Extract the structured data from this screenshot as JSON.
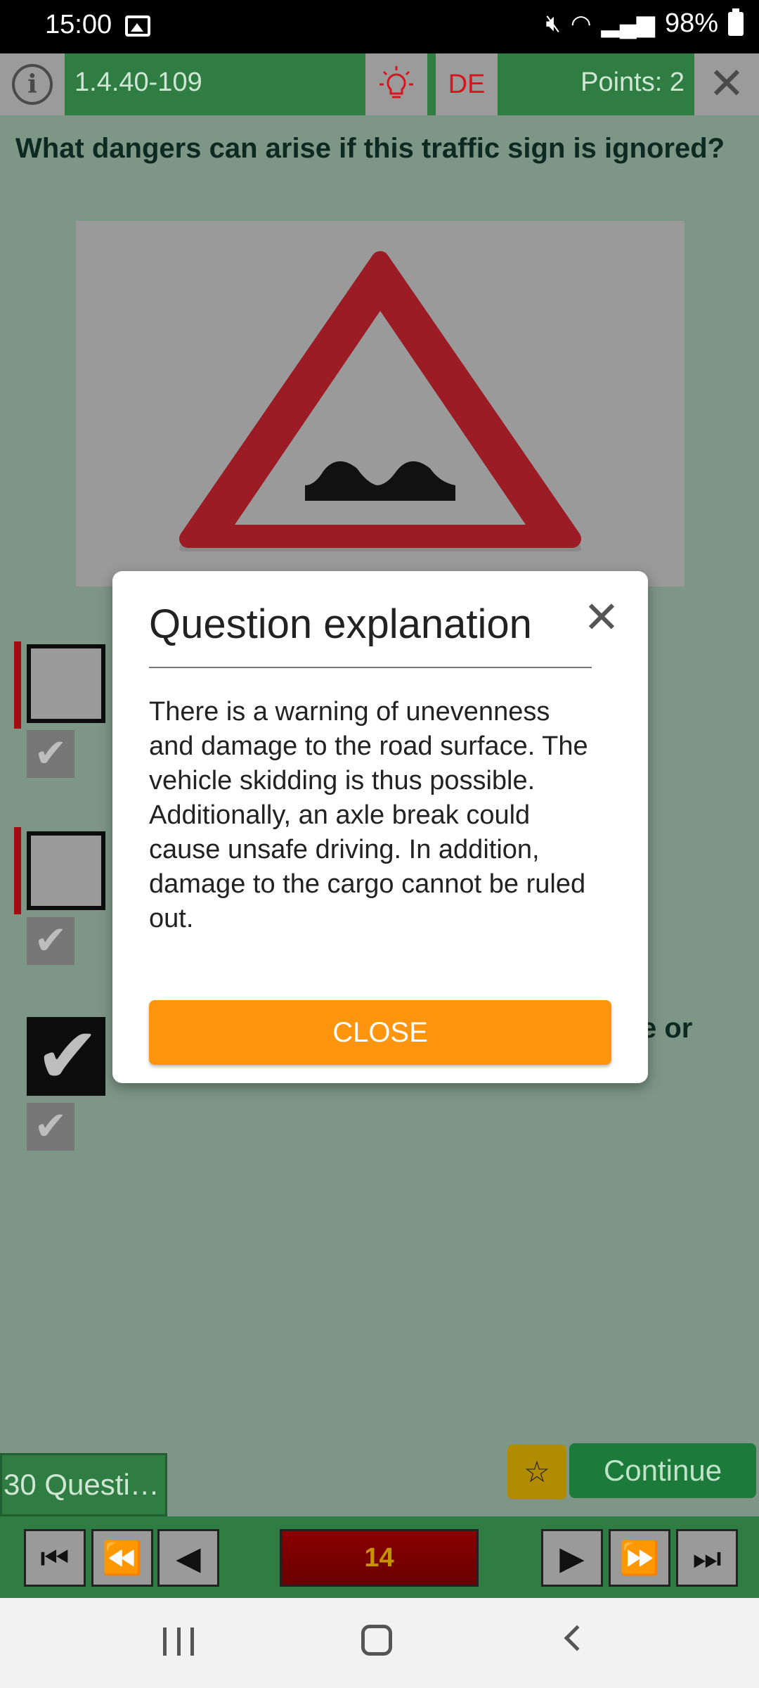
{
  "status_bar": {
    "time": "15:00",
    "battery": "98%"
  },
  "toolbar": {
    "code": "1.4.40-109",
    "language": "DE",
    "points": "Points: 2"
  },
  "question": {
    "text": "What dangers can arise if this traffic sign is ignored?",
    "image": "uneven-road-warning-sign"
  },
  "answers": {
    "partial_text_3": "e or"
  },
  "bottom": {
    "questions_tab": "30 Questi…",
    "continue_label": "Continue",
    "counter": "14"
  },
  "modal": {
    "title": "Question explanation",
    "body": "There is a warning of unevenness and damage to the road surface. The vehicle skidding is thus possible. Additionally, an axle break could cause unsafe driving. In addition, damage to the cargo cannot be ruled out.",
    "button_label": "CLOSE"
  },
  "colors": {
    "accent_green": "#2f7d42",
    "close_orange": "#ff940e",
    "sign_red": "#9b1c24"
  }
}
